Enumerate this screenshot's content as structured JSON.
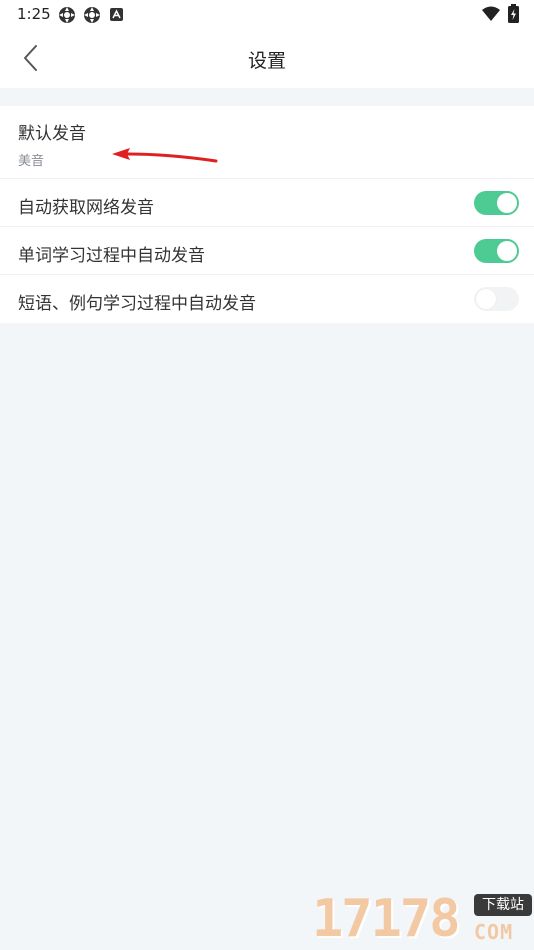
{
  "status_bar": {
    "time": "1:25",
    "icons": [
      "settings-gear-icon",
      "settings-gear-icon",
      "a-notification-icon",
      "wifi-icon",
      "battery-charging-icon"
    ]
  },
  "header": {
    "title": "设置",
    "back_icon": "chevron-left-icon"
  },
  "settings": {
    "default_pronunciation": {
      "label": "默认发音",
      "value": "美音"
    },
    "toggles": [
      {
        "label": "自动获取网络发音",
        "enabled": true
      },
      {
        "label": "单词学习过程中自动发音",
        "enabled": true
      },
      {
        "label": "短语、例句学习过程中自动发音",
        "enabled": false
      }
    ]
  },
  "watermark": {
    "digits": "17178",
    "badge": "下载站",
    "suffix": "COM"
  },
  "colors": {
    "toggle_on": "#4ecb93",
    "toggle_off": "#f1f3f5",
    "background": "#f2f6f9",
    "annotation_arrow": "#e02020"
  }
}
